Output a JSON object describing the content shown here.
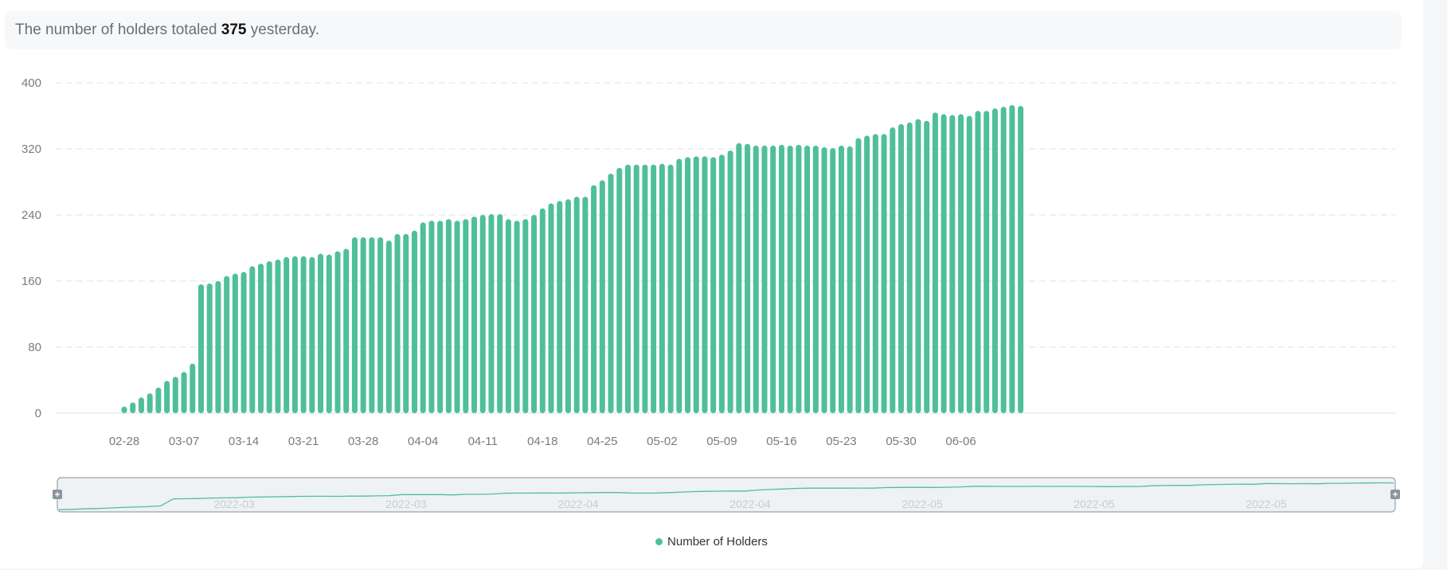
{
  "summary": {
    "prefix": "The number of holders totaled",
    "value": "375",
    "suffix": "yesterday."
  },
  "colors": {
    "bar": "#4fbf9a",
    "grid": "#e5e7ea",
    "axis_text": "#777b80",
    "slider_line": "#4fbf9a",
    "slider_fill": "#eef2f4",
    "slider_label": "#c7cdd2"
  },
  "chart_data": {
    "type": "bar",
    "title": "",
    "xlabel": "",
    "ylabel": "",
    "ylim": [
      0,
      400
    ],
    "yticks": [
      0,
      80,
      160,
      240,
      320,
      400
    ],
    "grid": true,
    "x": [
      "02-28",
      "03-01",
      "03-02",
      "03-03",
      "03-04",
      "03-05",
      "03-06",
      "03-07",
      "03-08",
      "03-09",
      "03-10",
      "03-11",
      "03-12",
      "03-13",
      "03-14",
      "03-15",
      "03-16",
      "03-17",
      "03-18",
      "03-19",
      "03-20",
      "03-21",
      "03-22",
      "03-23",
      "03-24",
      "03-25",
      "03-26",
      "03-27",
      "03-28",
      "03-29",
      "03-30",
      "03-31",
      "04-01",
      "04-02",
      "04-03",
      "04-04",
      "04-05",
      "04-06",
      "04-07",
      "04-08",
      "04-09",
      "04-10",
      "04-11",
      "04-12",
      "04-13",
      "04-14",
      "04-15",
      "04-16",
      "04-17",
      "04-18",
      "04-19",
      "04-20",
      "04-21",
      "04-22",
      "04-23",
      "04-24",
      "04-25",
      "04-26",
      "04-27",
      "04-28",
      "04-29",
      "04-30",
      "05-01",
      "05-02",
      "05-03",
      "05-04",
      "05-05",
      "05-06",
      "05-07",
      "05-08",
      "05-09",
      "05-10",
      "05-11",
      "05-12",
      "05-13",
      "05-14",
      "05-15",
      "05-16",
      "05-17",
      "05-18",
      "05-19",
      "05-20",
      "05-21",
      "05-22",
      "05-23",
      "05-24",
      "05-25",
      "05-26",
      "05-27",
      "05-28",
      "05-29",
      "05-30",
      "05-31",
      "06-01",
      "06-02",
      "06-03",
      "06-04",
      "06-05",
      "06-06",
      "06-07",
      "06-08",
      "06-09",
      "06-10",
      "06-11",
      "06-12"
    ],
    "xticks": [
      "02-28",
      "03-07",
      "03-14",
      "03-21",
      "03-28",
      "04-04",
      "04-11",
      "04-18",
      "04-25",
      "05-02",
      "05-09",
      "05-16",
      "05-23",
      "05-30",
      "06-06"
    ],
    "series": [
      {
        "name": "Number of Holders",
        "values": [
          8,
          13,
          19,
          24,
          31,
          39,
          44,
          50,
          60,
          156,
          157,
          160,
          166,
          169,
          171,
          178,
          181,
          184,
          186,
          189,
          190,
          190,
          189,
          193,
          192,
          196,
          199,
          213,
          213,
          213,
          213,
          209,
          217,
          217,
          221,
          231,
          233,
          233,
          235,
          233,
          235,
          238,
          240,
          241,
          241,
          235,
          233,
          235,
          240,
          248,
          254,
          257,
          259,
          262,
          262,
          276,
          282,
          290,
          297,
          301,
          301,
          301,
          301,
          302,
          301,
          308,
          310,
          311,
          311,
          310,
          313,
          318,
          327,
          326,
          324,
          324,
          324,
          325,
          324,
          325,
          324,
          324,
          322,
          321,
          324,
          323,
          333,
          336,
          338,
          338,
          346,
          350,
          352,
          356,
          354,
          364,
          362,
          361,
          362,
          360,
          366,
          366,
          369,
          371,
          373,
          372
        ]
      }
    ],
    "legend": {
      "position": "bottom",
      "entries": [
        "Number of Holders"
      ]
    },
    "slider_labels": [
      "2022-03",
      "2022-03",
      "2022-04",
      "2022-04",
      "2022-05",
      "2022-05",
      "2022-05"
    ]
  }
}
